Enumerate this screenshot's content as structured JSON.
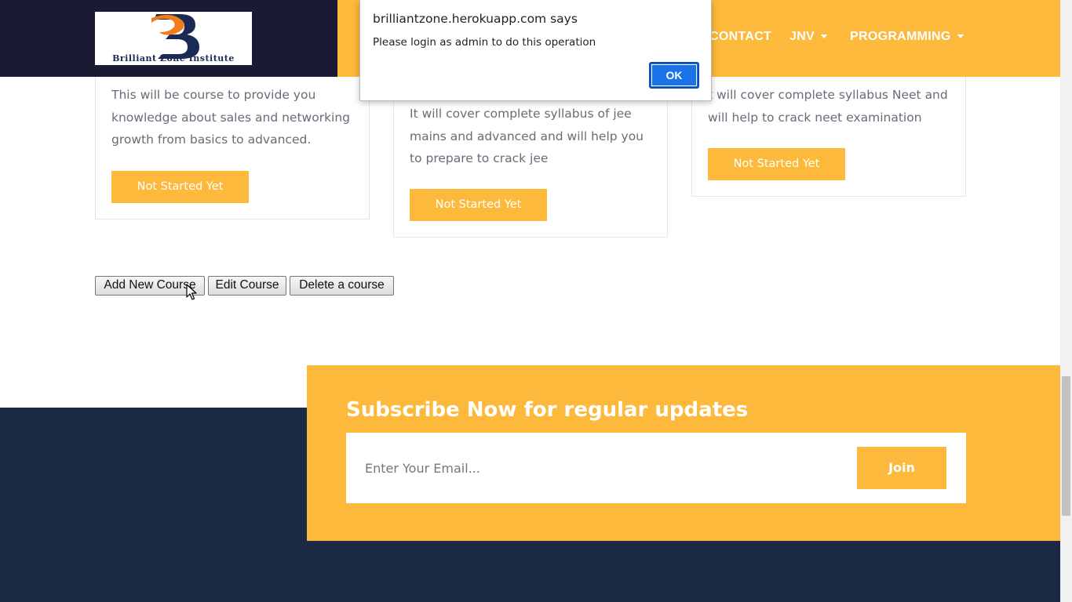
{
  "header": {
    "logo_text": "Brilliant Zone Institute",
    "nav": {
      "contact": "CONTACT",
      "jnv": "JNV",
      "programming": "PROGRAMMING"
    }
  },
  "courses": [
    {
      "description": "This will be course to provide you knowledge about sales and networking growth from basics to advanced.",
      "status": "Not Started Yet"
    },
    {
      "description": "It will cover complete syllabus of jee mains and advanced and will help you to prepare to crack jee",
      "status": "Not Started Yet"
    },
    {
      "description": "t will cover complete syllabus Neet and will help to crack neet examination",
      "status": "Not Started Yet"
    }
  ],
  "admin": {
    "add": "Add New Course",
    "edit": "Edit Course",
    "delete": "Delete a course"
  },
  "subscribe": {
    "title": "Subscribe Now for regular updates",
    "placeholder": "Enter Your Email...",
    "join": "Join"
  },
  "dialog": {
    "title": "brilliantzone.herokuapp.com says",
    "message": "Please login as admin to do this operation",
    "ok": "OK"
  },
  "colors": {
    "accent": "#fdb93b",
    "header_dark": "#1a1a32",
    "footer_dark": "#1c2942",
    "dialog_button": "#1a73e8"
  }
}
